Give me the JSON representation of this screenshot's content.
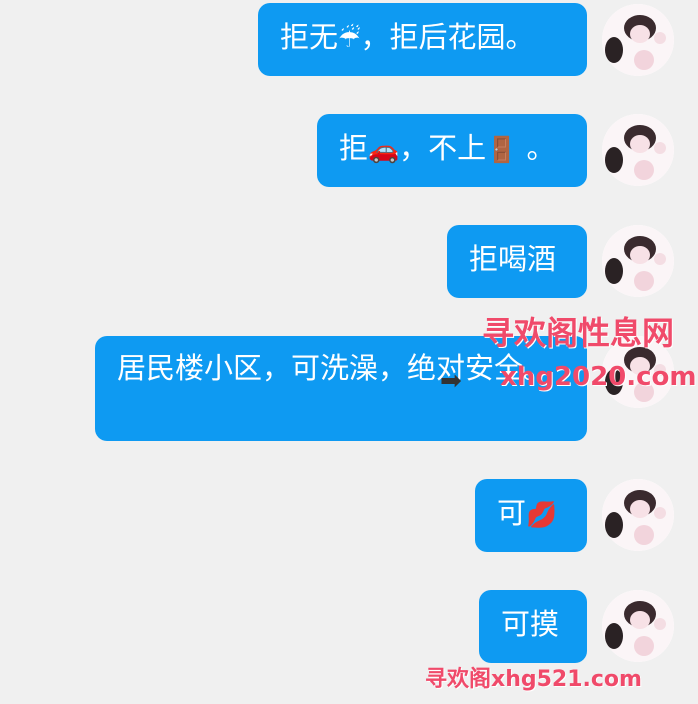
{
  "messages": [
    {
      "text": "拒无",
      "emoji": "☔",
      "tail": "，拒后花园。"
    },
    {
      "text": "拒",
      "emoji": "🚗",
      "middle": "，不上",
      "emoji2": "🚪",
      "tail": " 。"
    },
    {
      "text": "拒喝酒"
    },
    {
      "text": "居民楼小区，可洗澡，绝对安全。"
    },
    {
      "text": "可",
      "emoji": "💋"
    },
    {
      "text": "可摸"
    }
  ],
  "watermarks": {
    "line1": "寻欢阁性息网",
    "line2": "xhg2020.com",
    "line3": "寻欢阁xhg521.com",
    "arrow": "➡"
  },
  "colors": {
    "bubble": "#0e9af2",
    "background": "#f0f0f0",
    "bubble_text": "#ffffff"
  }
}
